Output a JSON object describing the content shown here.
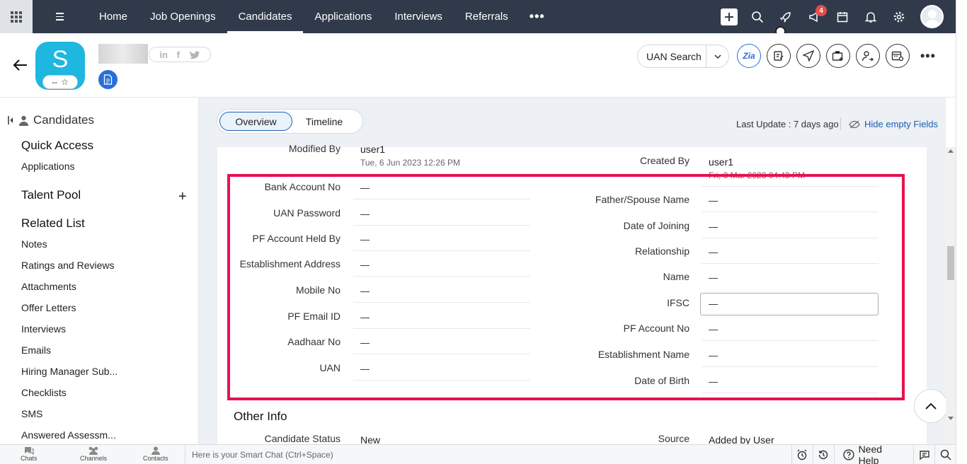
{
  "topnav": {
    "tabs": [
      {
        "label": "Home",
        "active": false
      },
      {
        "label": "Job Openings",
        "active": false
      },
      {
        "label": "Candidates",
        "active": true
      },
      {
        "label": "Applications",
        "active": false
      },
      {
        "label": "Interviews",
        "active": false
      },
      {
        "label": "Referrals",
        "active": false
      }
    ],
    "more_label": "•••",
    "notification_count": "4"
  },
  "header": {
    "avatar_letter": "S",
    "rating_text": "--",
    "rating_star": "☆",
    "uan_search_label": "UAN Search",
    "zia_label": "Zia",
    "more_label": "•••"
  },
  "sidebar": {
    "title": "Candidates",
    "quick_access": "Quick Access",
    "quick_items": [
      "Applications"
    ],
    "talent_pool": "Talent Pool",
    "related_list": "Related List",
    "related_items": [
      "Notes",
      "Ratings and Reviews",
      "Attachments",
      "Offer Letters",
      "Interviews",
      "Emails",
      "Hiring Manager Sub...",
      "Checklists",
      "SMS",
      "Answered Assessm..."
    ]
  },
  "main": {
    "tabs": {
      "overview": "Overview",
      "timeline": "Timeline"
    },
    "last_update": "Last Update : 7 days ago",
    "hide_empty": "Hide empty Fields",
    "modified_by": {
      "label": "Modified By",
      "value": "user1",
      "date": "Tue, 6 Jun 2023 12:26 PM"
    },
    "created_by": {
      "label": "Created By",
      "value": "user1",
      "date": "Fri, 3 Mar 2023 04:43 PM"
    },
    "left_fields": [
      {
        "label": "Bank Account No",
        "value": "—"
      },
      {
        "label": "UAN Password",
        "value": "—"
      },
      {
        "label": "PF Account Held By",
        "value": "—"
      },
      {
        "label": "Establishment Address",
        "value": "—"
      },
      {
        "label": "Mobile No",
        "value": "—"
      },
      {
        "label": "PF Email ID",
        "value": "—"
      },
      {
        "label": "Aadhaar No",
        "value": "—"
      },
      {
        "label": "UAN",
        "value": "—"
      }
    ],
    "right_fields": [
      {
        "label": "Father/Spouse Name",
        "value": "—"
      },
      {
        "label": "Date of Joining",
        "value": "—"
      },
      {
        "label": "Relationship",
        "value": "—"
      },
      {
        "label": "Name",
        "value": "—"
      },
      {
        "label": "IFSC",
        "value": "—"
      },
      {
        "label": "PF Account No",
        "value": "—"
      },
      {
        "label": "Establishment Name",
        "value": "—"
      },
      {
        "label": "Date of Birth",
        "value": "—"
      }
    ],
    "other_info_title": "Other Info",
    "candidate_status": {
      "label": "Candidate Status",
      "value": "New"
    },
    "source": {
      "label": "Source",
      "value": "Added by User"
    }
  },
  "bottombar": {
    "chats": "Chats",
    "channels": "Channels",
    "contacts": "Contacts",
    "smart_chat_placeholder": "Here is your Smart Chat (Ctrl+Space)",
    "need_help": "Need Help"
  },
  "colors": {
    "topnav_bg": "#313a4a",
    "avatar_bg": "#1eb7e0",
    "accent_blue": "#1a5fb4",
    "highlight_border": "#e8114f",
    "badge": "#e54b4b"
  }
}
